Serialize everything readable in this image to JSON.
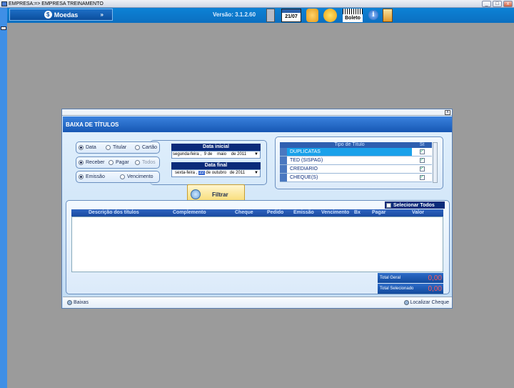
{
  "titlebar": {
    "title": "EMPRESA:=> EMPRESA TREINAMENTO",
    "min": "_",
    "max": "□",
    "close": "x"
  },
  "toolbar": {
    "moedas_label": "Moedas",
    "dollar_glyph": "$",
    "chevron": "»",
    "versao": "Versão: 3.1.2.60",
    "calendar_date": "21/07",
    "boleto_label": "Boleto",
    "info_glyph": "i"
  },
  "dialog": {
    "close": "x",
    "title": "BAIXA DE TÍTULOS",
    "radios_row1": [
      {
        "label": "Data",
        "checked": true
      },
      {
        "label": "Titular",
        "checked": false
      },
      {
        "label": "Cartão",
        "checked": false
      }
    ],
    "radios_row2": [
      {
        "label": "Receber",
        "checked": true
      },
      {
        "label": "Pagar",
        "checked": false
      },
      {
        "label": "Todos",
        "checked": false,
        "disabled": true
      }
    ],
    "radios_row3": [
      {
        "label": "Emissão",
        "checked": true
      },
      {
        "label": "Vencimento",
        "checked": false
      }
    ],
    "data_inicial": {
      "label": "Data inicial",
      "weekday": "segunda-feira ,",
      "day": "9",
      "de1": "de",
      "month": "maio",
      "de2": "de",
      "year": "2011"
    },
    "data_final": {
      "label": "Data final",
      "weekday": "sexta-feira ,",
      "day": "22",
      "de1": "de",
      "month": "outubro",
      "de2": "de",
      "year": "2011"
    },
    "filtrar_label": "Filtrar",
    "tipo_titulo": {
      "header_name": "Tipo de Título",
      "header_st": "St",
      "rows": [
        {
          "name": "DUPLICATAS",
          "checked": true,
          "active": true
        },
        {
          "name": "TED (SISPAG)",
          "checked": true,
          "active": false
        },
        {
          "name": "CREDIARIO",
          "checked": true,
          "active": false
        },
        {
          "name": "CHEQUE(S)",
          "checked": true,
          "active": false
        }
      ]
    },
    "selecionar_todos": "Selecionar Todos",
    "grid_columns": [
      "Descrição dos títulos",
      "Complemento",
      "Cheque",
      "Pedido",
      "Emissão",
      "Vencimento",
      "Bx",
      "Pagar",
      "Valor"
    ],
    "total_geral": {
      "label": "Total Geral",
      "value": "0,00"
    },
    "total_selecionado": {
      "label": "Total Selecionado",
      "value": "0,00"
    },
    "footer": {
      "baixas": "Baixas",
      "localizar": "Localizar Cheque"
    },
    "check_glyph": "✓"
  }
}
